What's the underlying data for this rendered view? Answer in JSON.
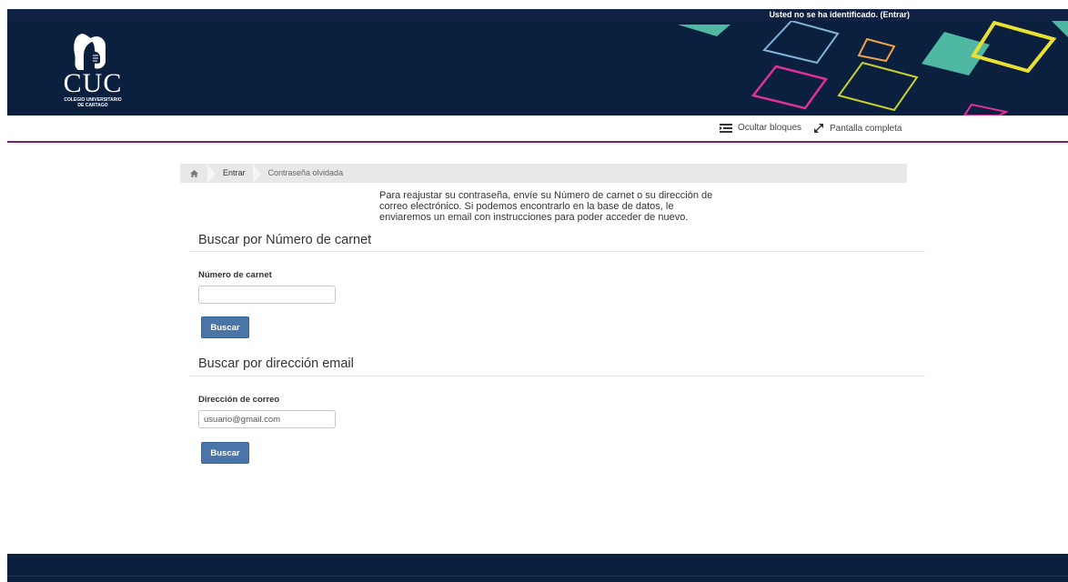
{
  "user_bar": {
    "status_text": "Usted no se ha identificado.",
    "login_link": "(Entrar)"
  },
  "logo": {
    "acronym": "CUC",
    "line1": "COLEGIO UNIVERSITARIO",
    "line2": "DE CARTAGO"
  },
  "toolbar": {
    "hide_blocks": "Ocultar bloques",
    "fullscreen": "Pantalla completa"
  },
  "breadcrumb": {
    "home_icon": "home-icon",
    "items": [
      "Entrar",
      "Contraseña olvidada"
    ]
  },
  "intro": {
    "line1": "Para reajustar su contraseña, envíe su Número de carnet o su dirección de",
    "line2": "correo electrónico. Si podemos encontrarlo en la base de datos, le",
    "line3": "enviaremos un email con instrucciones para poder acceder de nuevo."
  },
  "carnet_section": {
    "title": "Buscar por Número de carnet",
    "label": "Número de carnet",
    "value": "",
    "button": "Buscar"
  },
  "email_section": {
    "title": "Buscar por dirección email",
    "label": "Dirección de correo",
    "value": "usuario@gmail.com",
    "button": "Buscar"
  },
  "colors": {
    "header_bg": "#0b1f3f",
    "accent_line": "#7e1f73",
    "button": "#4a75a8"
  }
}
